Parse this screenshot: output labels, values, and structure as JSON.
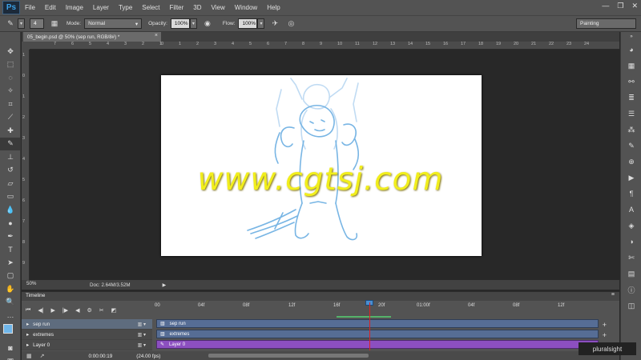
{
  "menubar": {
    "logo": "Ps",
    "items": [
      "File",
      "Edit",
      "Image",
      "Layer",
      "Type",
      "Select",
      "Filter",
      "3D",
      "View",
      "Window",
      "Help"
    ],
    "win_minimize": "—",
    "win_restore": "❐",
    "win_close": "✕"
  },
  "options": {
    "brush_size": "4",
    "mode_label": "Mode:",
    "mode_value": "Normal",
    "opacity_label": "Opacity:",
    "opacity_value": "100%",
    "flow_label": "Flow:",
    "flow_value": "100%",
    "workspace": "Painting"
  },
  "document": {
    "tab_title": "05_begin.psd @ 50% (sep run, RGB/8#) *",
    "close": "×",
    "watermark": "www.cgtsj.com"
  },
  "ruler": {
    "h": [
      "7",
      "6",
      "5",
      "4",
      "3",
      "2",
      "1",
      "0",
      "1",
      "2",
      "3",
      "4",
      "5",
      "6",
      "7",
      "8",
      "9",
      "10",
      "11",
      "12",
      "13",
      "14",
      "15",
      "16",
      "17",
      "18",
      "19",
      "20",
      "21",
      "22",
      "23",
      "24"
    ],
    "v": [
      "1",
      "0",
      "1",
      "2",
      "3",
      "4",
      "5",
      "6",
      "7",
      "8",
      "9"
    ]
  },
  "status": {
    "zoom": "50%",
    "doc": "Doc: 2.64M/3.52M",
    "arrow": "▶"
  },
  "timeline": {
    "title": "Timeline",
    "controls": [
      "⏮",
      "◀|",
      "▶",
      "|▶",
      "◀",
      "⚙",
      "✂",
      "◩"
    ],
    "ruler": [
      "00",
      "04f",
      "08f",
      "12f",
      "16f",
      "20f",
      "01:00f",
      "04f",
      "08f",
      "12f"
    ],
    "tracks": [
      {
        "name": "sep run"
      },
      {
        "name": "extremes"
      },
      {
        "name": "Layer 0"
      }
    ],
    "time": "0:00:00:19",
    "fps": "(24.00 fps)"
  },
  "branding": "pluralsight"
}
